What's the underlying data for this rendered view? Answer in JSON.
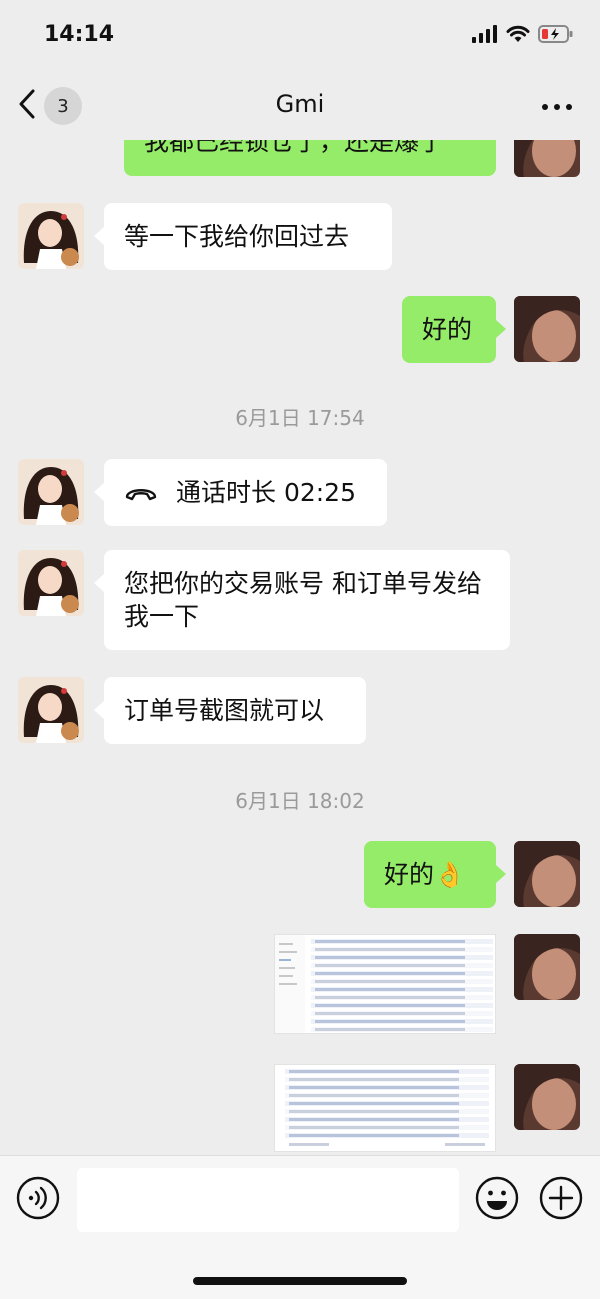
{
  "status_bar": {
    "time": "14:14"
  },
  "nav": {
    "back_count": "3",
    "title": "Gmi"
  },
  "colors": {
    "outgoing_bubble": "#95ec69",
    "incoming_bubble": "#ffffff",
    "background": "#ededed"
  },
  "messages": [
    {
      "id": "m0",
      "direction": "out",
      "type": "text",
      "text": "我都已经锁仓了，还是爆了"
    },
    {
      "id": "m1",
      "direction": "in",
      "type": "text",
      "text": "等一下我给你回过去"
    },
    {
      "id": "m2",
      "direction": "out",
      "type": "text",
      "text": "好的"
    },
    {
      "id": "t1",
      "type": "timestamp",
      "text": "6月1日 17:54"
    },
    {
      "id": "m3",
      "direction": "in",
      "type": "call",
      "icon": "phone-hangup-icon",
      "text": "通话时长 02:25"
    },
    {
      "id": "m4",
      "direction": "in",
      "type": "text",
      "text": "您把你的交易账号 和订单号发给我一下"
    },
    {
      "id": "m5",
      "direction": "in",
      "type": "text",
      "text": "订单号截图就可以"
    },
    {
      "id": "t2",
      "type": "timestamp",
      "text": "6月1日 18:02"
    },
    {
      "id": "m6",
      "direction": "out",
      "type": "text",
      "text": "好的",
      "emoji": "👌"
    },
    {
      "id": "m7",
      "direction": "out",
      "type": "image",
      "description": "order-table-screenshot"
    },
    {
      "id": "m8",
      "direction": "out",
      "type": "image",
      "description": "order-table-screenshot"
    }
  ],
  "input_bar": {
    "voice_icon": "voice-icon",
    "emoji_icon": "emoji-icon",
    "plus_icon": "plus-icon",
    "value": ""
  }
}
